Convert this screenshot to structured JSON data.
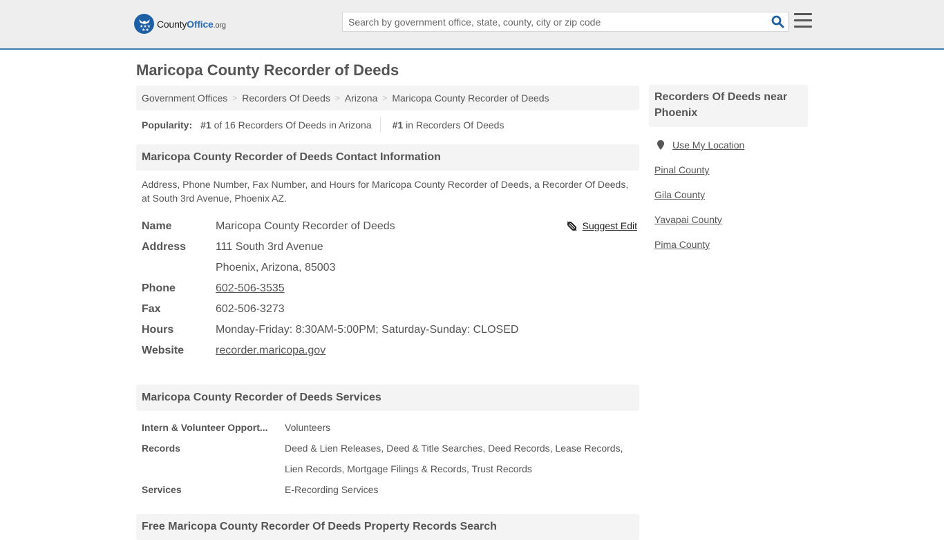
{
  "header": {
    "logo": {
      "county": "County",
      "office": "Office",
      "tld": ".org",
      "icon": "eagle-stars-badge-icon"
    },
    "search": {
      "placeholder": "Search by government office, state, county, city or zip code",
      "value": "",
      "icon": "search-icon"
    },
    "menu_icon": "hamburger-menu-icon"
  },
  "colors": {
    "brand_blue": "#1d5fa5",
    "header_bg": "#eeeeee",
    "header_border": "#3f7bae",
    "panel_bg": "#f4f4f4",
    "text": "#555555"
  },
  "page": {
    "title": "Maricopa County Recorder of Deeds"
  },
  "breadcrumb": [
    {
      "label": "Government Offices"
    },
    {
      "label": "Recorders Of Deeds"
    },
    {
      "label": "Arizona"
    },
    {
      "label": "Maricopa County Recorder of Deeds"
    }
  ],
  "popularity": {
    "label": "Popularity:",
    "state_rank": "#1",
    "state_text": "of 16 Recorders Of Deeds in Arizona",
    "overall_rank": "#1",
    "overall_text": "in Recorders Of Deeds"
  },
  "contact": {
    "heading": "Maricopa County Recorder of Deeds Contact Information",
    "description": "Address, Phone Number, Fax Number, and Hours for Maricopa County Recorder of Deeds, a Recorder Of Deeds, at South 3rd Avenue, Phoenix AZ.",
    "suggest_edit": "Suggest Edit",
    "fields": {
      "name_label": "Name",
      "name": "Maricopa County Recorder of Deeds",
      "address_label": "Address",
      "address_line1": "111 South 3rd Avenue",
      "address_line2": "Phoenix, Arizona, 85003",
      "phone_label": "Phone",
      "phone": "602-506-3535",
      "fax_label": "Fax",
      "fax": "602-506-3273",
      "hours_label": "Hours",
      "hours": "Monday-Friday: 8:30AM-5:00PM; Saturday-Sunday: CLOSED",
      "website_label": "Website",
      "website": "recorder.maricopa.gov"
    }
  },
  "services": {
    "heading": "Maricopa County Recorder of Deeds Services",
    "rows": [
      {
        "label": "Intern & Volunteer Opport...",
        "value": "Volunteers"
      },
      {
        "label": "Records",
        "value": "Deed & Lien Releases, Deed & Title Searches, Deed Records, Lease Records, Lien Records, Mortgage Filings & Records, Trust Records"
      },
      {
        "label": "Services",
        "value": "E-Recording Services"
      }
    ]
  },
  "property_search": {
    "heading": "Free Maricopa County Recorder Of Deeds Property Records Search"
  },
  "sidebar": {
    "heading": "Recorders Of Deeds near Phoenix",
    "use_location": "Use My Location",
    "links": [
      {
        "label": "Pinal County"
      },
      {
        "label": "Gila County"
      },
      {
        "label": "Yavapai County"
      },
      {
        "label": "Pima County"
      }
    ]
  }
}
